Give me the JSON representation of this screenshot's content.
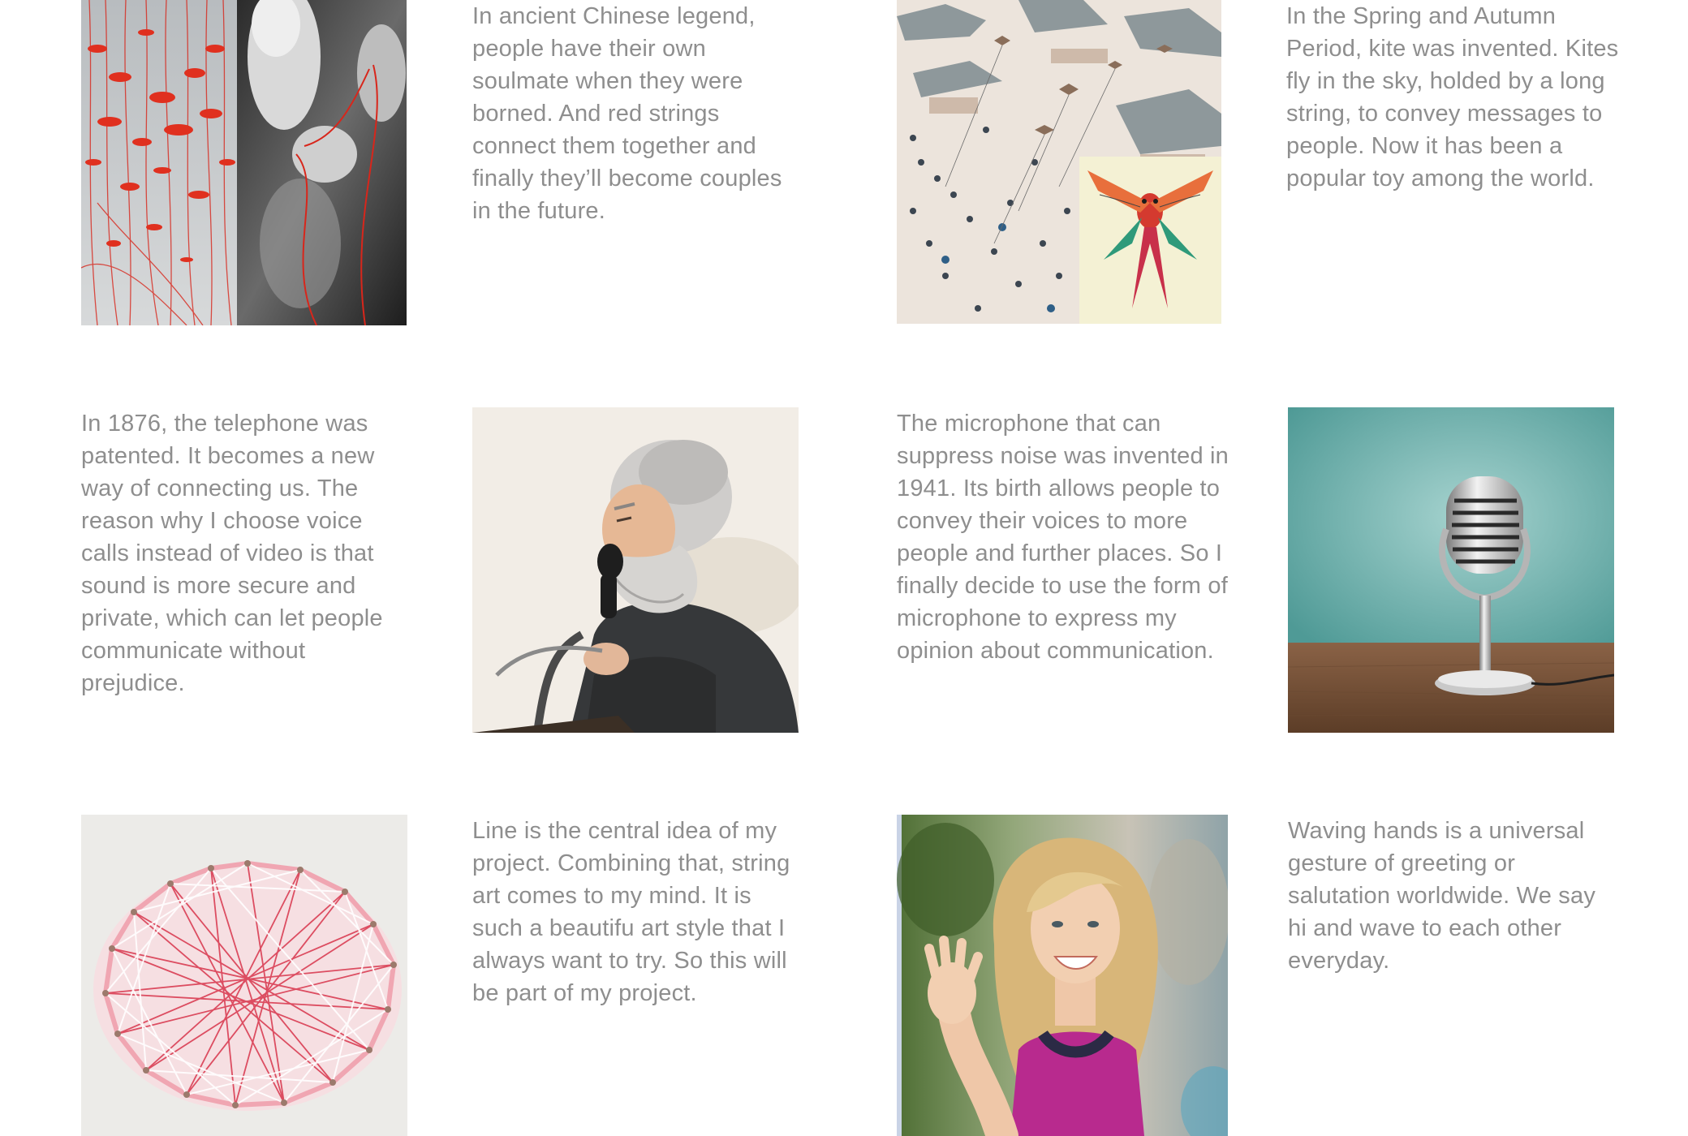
{
  "texts": {
    "legend": "In ancient Chinese legend, people have their own soulmate when they were borned. And red strings connect them together and finally they’ll become couples in the future.",
    "kite": "In the Spring and Autumn Period, kite was invented. Kites fly in the sky, holded by a long string, to convey messages to people. Now it has been a popular toy among the world.",
    "telephone": "In 1876, the telephone was patented. It becomes a new way of connecting us. The reason why I choose voice calls instead of video is that sound is more secure and private, which can let people communicate without prejudice.",
    "microphone": "The microphone that can suppress noise was invented in 1941. Its birth allows people to convey their voices to more people and further places. So I finally decide to use the form of microphone to express my opinion about communication.",
    "string_art": "Line is the central idea of my project. Combining that, string art comes to my mind. It is such a beautifu art style that I always want to try. So this will be part of my project.",
    "waving": "Waving hands is a universal gesture of greeting or salutation worldwide. We say hi and wave to each other everyday."
  },
  "images": {
    "red_strings": "red-strings-photo",
    "kite_painting": "kite-painting",
    "inventor": "inventor-telephone-illustration",
    "microphone": "vintage-microphone-photo",
    "string_art": "string-art-photo",
    "waving_woman": "waving-woman-photo"
  },
  "colors": {
    "text": "#8e8e8e",
    "background": "#ffffff",
    "red_string": "#d8261b",
    "mic_wall": "#6fb3ad",
    "string_art_red": "#d8344b",
    "dress_magenta": "#b82a8e"
  }
}
